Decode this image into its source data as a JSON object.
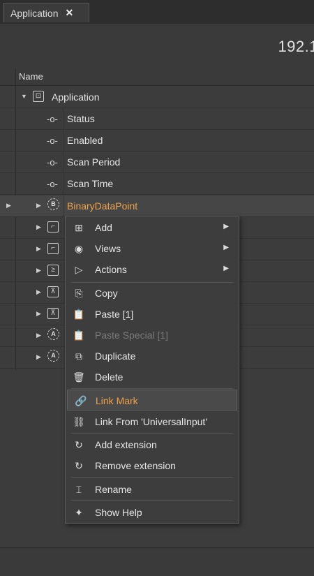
{
  "tab": {
    "title": "Application",
    "close_icon": "close-icon"
  },
  "header": {
    "ip": "192.1"
  },
  "grid": {
    "column_name": "Name"
  },
  "tree": {
    "root": {
      "label": "Application",
      "icon": "application-icon"
    },
    "children": [
      {
        "label": "Status",
        "icon": "pin-icon"
      },
      {
        "label": "Enabled",
        "icon": "pin-icon"
      },
      {
        "label": "Scan Period",
        "icon": "pin-icon"
      },
      {
        "label": "Scan Time",
        "icon": "pin-icon"
      },
      {
        "label": "BinaryDataPoint",
        "icon": "binary-datapoint-icon",
        "selected": true
      }
    ]
  },
  "context_menu": {
    "items": [
      {
        "label": "Add",
        "icon": "add-icon",
        "submenu": true
      },
      {
        "label": "Views",
        "icon": "eye-icon",
        "submenu": true
      },
      {
        "label": "Actions",
        "icon": "play-icon",
        "submenu": true
      },
      {
        "label": "Copy",
        "icon": "copy-icon"
      },
      {
        "label": "Paste [1]",
        "icon": "paste-icon"
      },
      {
        "label": "Paste Special [1]",
        "icon": "paste-special-icon",
        "disabled": true
      },
      {
        "label": "Duplicate",
        "icon": "duplicate-icon"
      },
      {
        "label": "Delete",
        "icon": "trash-icon"
      },
      {
        "label": "Link Mark",
        "icon": "link-icon",
        "highlighted": true
      },
      {
        "label": "Link From 'UniversalInput'",
        "icon": "link-from-icon"
      },
      {
        "label": "Add extension",
        "icon": "extension-icon"
      },
      {
        "label": "Remove extension",
        "icon": "extension-icon"
      },
      {
        "label": "Rename",
        "icon": "rename-icon"
      },
      {
        "label": "Show Help",
        "icon": "help-icon"
      }
    ]
  },
  "colors": {
    "accent": "#f0a24a",
    "background": "#3c3c3c"
  }
}
